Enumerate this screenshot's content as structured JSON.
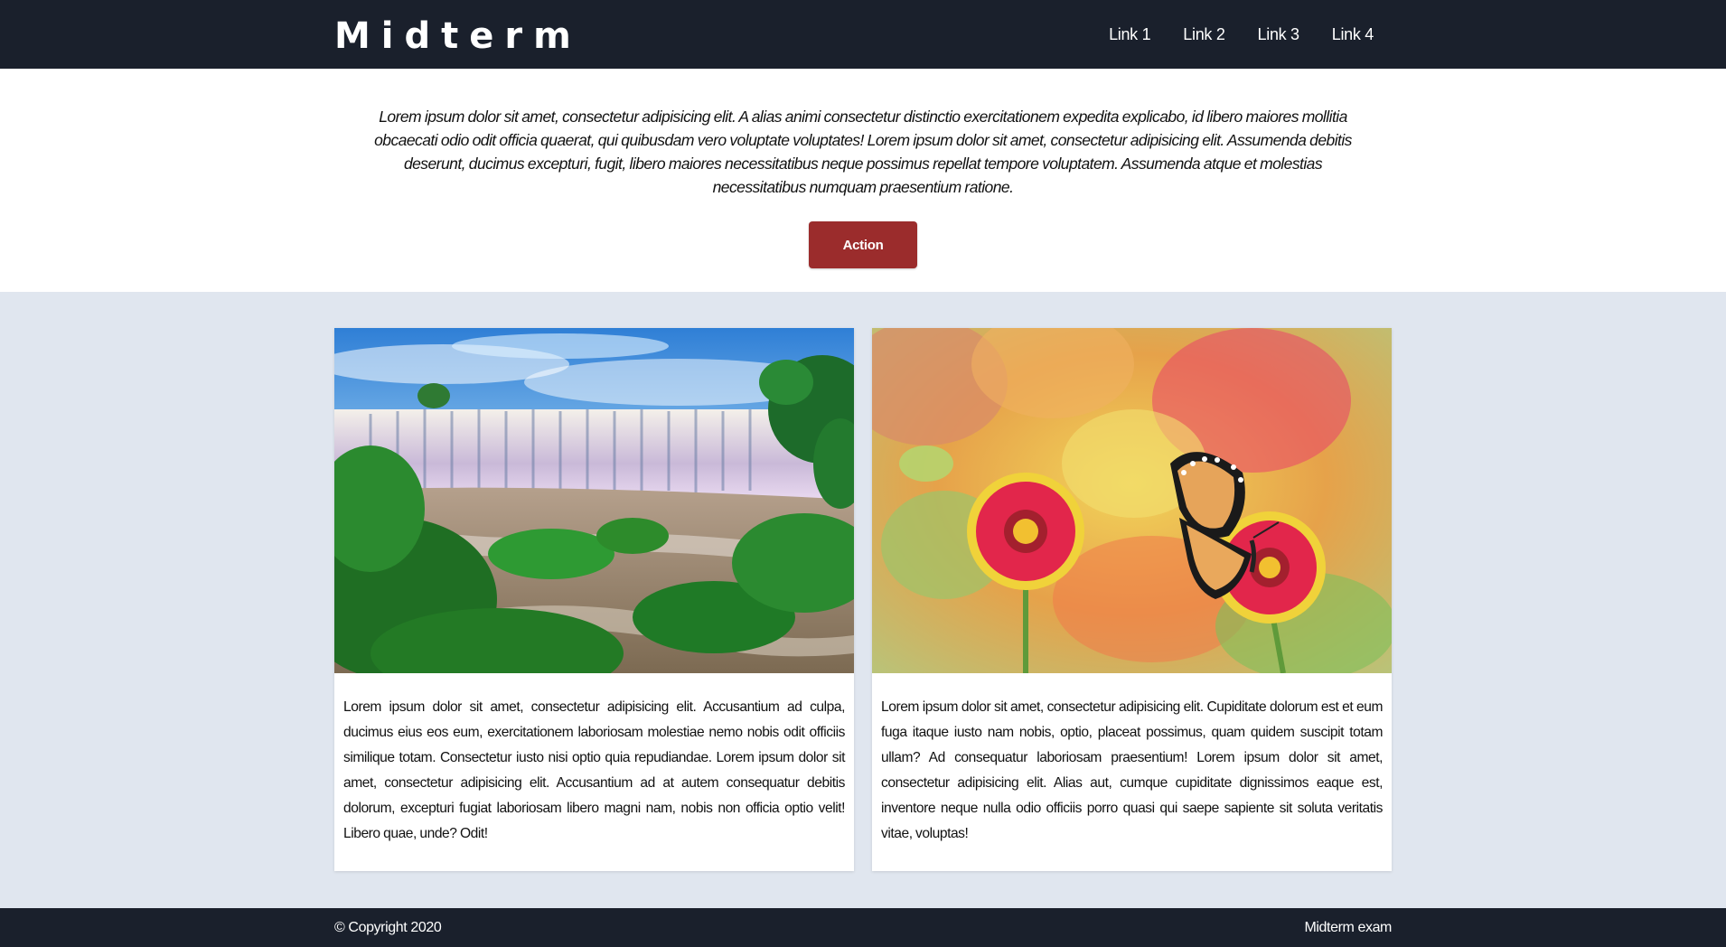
{
  "header": {
    "logo": "Midterm",
    "nav": [
      "Link 1",
      "Link 2",
      "Link 3",
      "Link 4"
    ]
  },
  "hero": {
    "text": "Lorem ipsum dolor sit amet, consectetur adipisicing elit. A alias animi consectetur distinctio exercitationem expedita explicabo, id libero maiores mollitia obcaecati odio odit officia quaerat, qui quibusdam vero voluptate voluptates! Lorem ipsum dolor sit amet, consectetur adipisicing elit. Assumenda debitis deserunt, ducimus excepturi, fugit, libero maiores necessitatibus neque possimus repellat tempore voluptatem. Assumenda atque et molestias necessitatibus numquam praesentium ratione.",
    "button": "Action"
  },
  "cards": [
    {
      "image": "waterfall-landscape",
      "text": "Lorem ipsum dolor sit amet, consectetur adipisicing elit. Accusantium ad culpa, ducimus eius eos eum, exercitationem laboriosam molestiae nemo nobis odit officiis similique totam. Consectetur iusto nisi optio quia repudiandae. Lorem ipsum dolor sit amet, consectetur adipisicing elit. Accusantium ad at autem consequatur debitis dolorum, excepturi fugiat laboriosam libero magni nam, nobis non officia optio velit! Libero quae, unde? Odit!"
    },
    {
      "image": "butterfly-on-flower",
      "text": "Lorem ipsum dolor sit amet, consectetur adipisicing elit. Cupiditate dolorum est et eum fuga itaque iusto nam nobis, optio, placeat possimus, quam quidem suscipit totam ullam? Ad consequatur laboriosam praesentium! Lorem ipsum dolor sit amet, consectetur adipisicing elit. Alias aut, cumque cupiditate dignissimos eaque est, inventore neque nulla odio officiis porro quasi qui saepe sapiente sit soluta veritatis vitae, voluptas!"
    }
  ],
  "footer": {
    "copyright": "© Copyright 2020",
    "right": "Midterm exam"
  },
  "colors": {
    "header_bg": "#1a202c",
    "page_bg": "#e0e6ef",
    "action_button": "#9b2c2c"
  }
}
